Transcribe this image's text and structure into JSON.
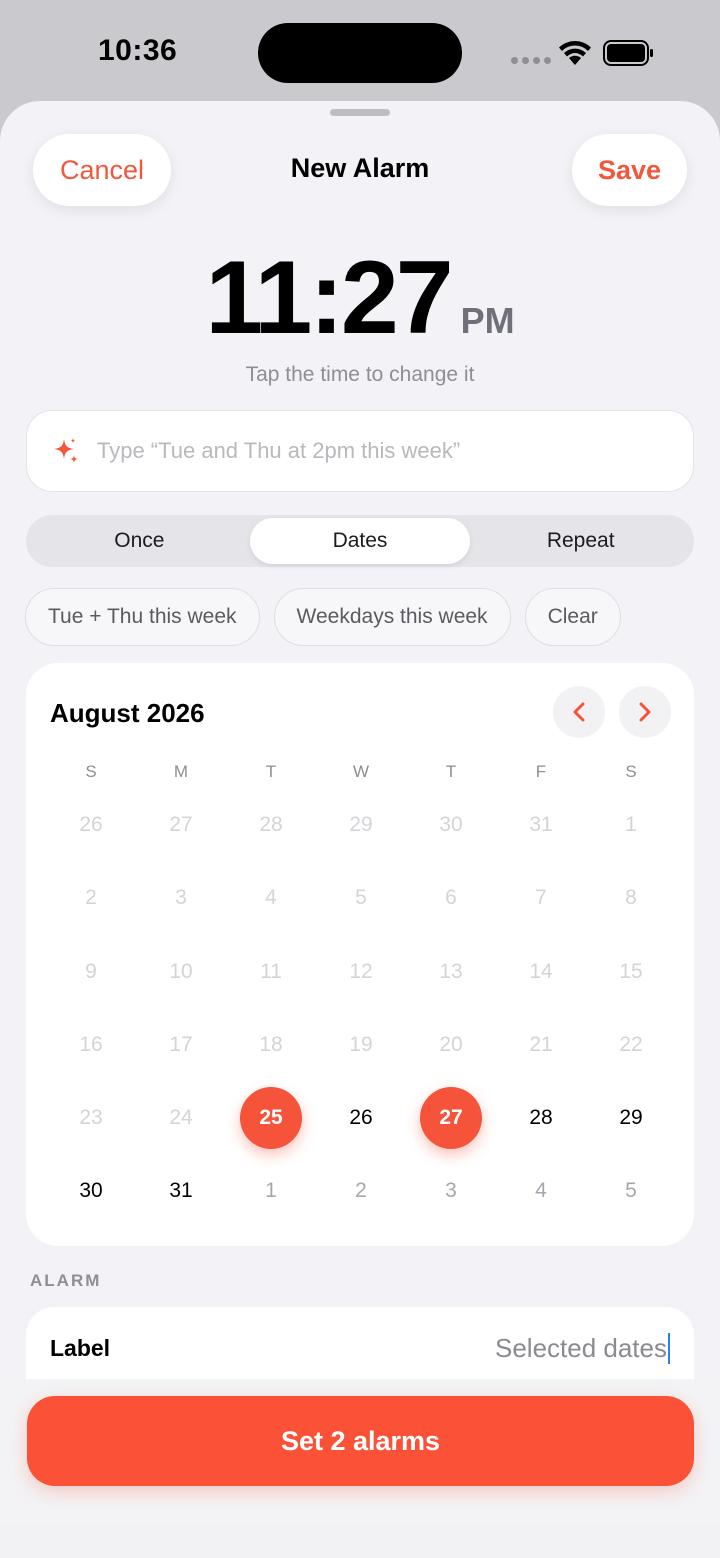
{
  "status_bar": {
    "time": "10:36"
  },
  "header": {
    "cancel_label": "Cancel",
    "title": "New Alarm",
    "save_label": "Save"
  },
  "time_display": {
    "time": "11:27",
    "period": "PM",
    "hint": "Tap the time to change it"
  },
  "natural_input": {
    "value": "",
    "placeholder": "Type “Tue and Thu at 2pm this week”"
  },
  "mode_tabs": [
    {
      "label": "Once",
      "active": false
    },
    {
      "label": "Dates",
      "active": true
    },
    {
      "label": "Repeat",
      "active": false
    }
  ],
  "quick_chips": [
    "Tue + Thu this week",
    "Weekdays this week",
    "Clear"
  ],
  "calendar": {
    "month_title": "August 2026",
    "weekdays": [
      "S",
      "M",
      "T",
      "W",
      "T",
      "F",
      "S"
    ],
    "weeks": [
      [
        "26",
        "27",
        "28",
        "29",
        "30",
        "31",
        "1"
      ],
      [
        "2",
        "3",
        "4",
        "5",
        "6",
        "7",
        "8"
      ],
      [
        "9",
        "10",
        "11",
        "12",
        "13",
        "14",
        "15"
      ],
      [
        "16",
        "17",
        "18",
        "19",
        "20",
        "21",
        "22"
      ],
      [
        "23",
        "24",
        "25",
        "26",
        "27",
        "28",
        "29"
      ],
      [
        "30",
        "31",
        "1",
        "2",
        "3",
        "4",
        "5"
      ]
    ],
    "states": [
      [
        "muted",
        "muted",
        "muted",
        "muted",
        "muted",
        "muted",
        "muted"
      ],
      [
        "muted",
        "muted",
        "muted",
        "muted",
        "muted",
        "muted",
        "muted"
      ],
      [
        "muted",
        "muted",
        "muted",
        "muted",
        "muted",
        "muted",
        "muted"
      ],
      [
        "muted",
        "muted",
        "muted",
        "muted",
        "muted",
        "muted",
        "muted"
      ],
      [
        "muted",
        "muted",
        "selected",
        "current",
        "selected",
        "current",
        "current"
      ],
      [
        "current",
        "current",
        "outside",
        "outside",
        "outside",
        "outside",
        "outside"
      ]
    ],
    "accent_color": "#f5543a"
  },
  "alarm_section": {
    "heading": "ALARM",
    "label_title": "Label",
    "label_value": "Selected dates"
  },
  "cta": {
    "label": "Set 2 alarms"
  }
}
